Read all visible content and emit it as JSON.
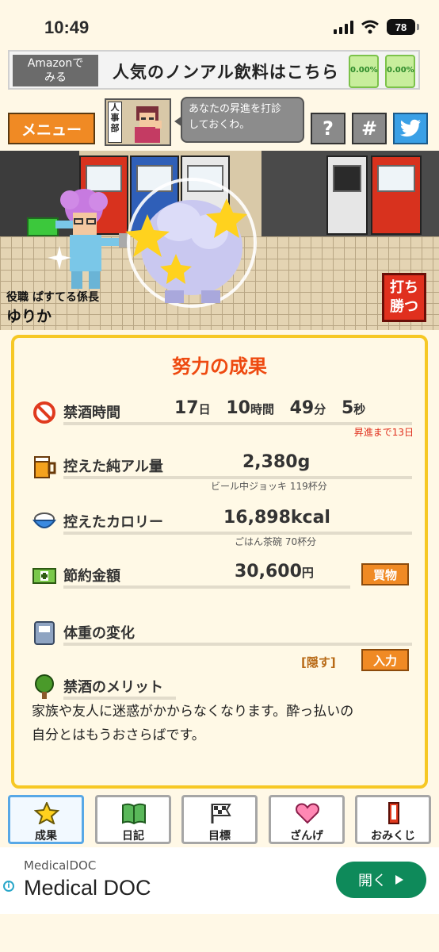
{
  "status_bar": {
    "time": "10:49",
    "battery": "78"
  },
  "top_ad": {
    "badge_line1": "Amazonで",
    "badge_line2": "みる",
    "text": "人気のノンアル飲料はこちら",
    "can_label": "0.00%"
  },
  "header": {
    "menu_label": "メニュー",
    "avatar_sign": "人事部",
    "speech_line1": "あなたの昇進を打診",
    "speech_line2": "しておくわ。",
    "help_label": "?",
    "hashtag_label": "#"
  },
  "scene": {
    "role_label": "役職 ぱすてる係長",
    "character_name": "ゆりか",
    "fight_line1": "打ち",
    "fight_line2": "勝つ"
  },
  "panel": {
    "title": "努力の成果",
    "abstinence": {
      "label": "禁酒時間",
      "days": "17",
      "days_unit": "日",
      "hours": "10",
      "hours_unit": "時間",
      "minutes": "49",
      "minutes_unit": "分",
      "seconds": "5",
      "seconds_unit": "秒",
      "promotion": "昇進まで13日"
    },
    "alcohol": {
      "label": "控えた純アル量",
      "value": "2,380",
      "unit": "g",
      "sub": "ビール中ジョッキ 119杯分"
    },
    "calories": {
      "label": "控えたカロリー",
      "value": "16,898",
      "unit": "kcal",
      "sub": "ごはん茶碗 70杯分"
    },
    "savings": {
      "label": "節約金額",
      "value": "30,600",
      "unit": "円",
      "button": "買物"
    },
    "weight": {
      "label": "体重の変化",
      "hide": "[隠す]",
      "button": "入力"
    },
    "merit": {
      "label": "禁酒のメリット",
      "text_line1": "家族や友人に迷惑がかからなくなります。酔っ払いの",
      "text_line2": "自分とはもうおさらばです。"
    }
  },
  "nav": {
    "items": [
      {
        "label": "成果",
        "icon": "star-icon",
        "active": true
      },
      {
        "label": "日記",
        "icon": "book-icon"
      },
      {
        "label": "目標",
        "icon": "flag-icon"
      },
      {
        "label": "ざんげ",
        "icon": "heart-icon"
      },
      {
        "label": "おみくじ",
        "icon": "omikuji-icon"
      }
    ]
  },
  "bottom_ad": {
    "sponsor": "MedicalDOC",
    "title": "Medical DOC",
    "button": "開く"
  },
  "colors": {
    "accent_orange": "#f08a24",
    "title_red": "#ee4a10",
    "panel_border": "#f6c825",
    "ad_green": "#0e8a5a",
    "twitter_blue": "#3aa0e6"
  }
}
